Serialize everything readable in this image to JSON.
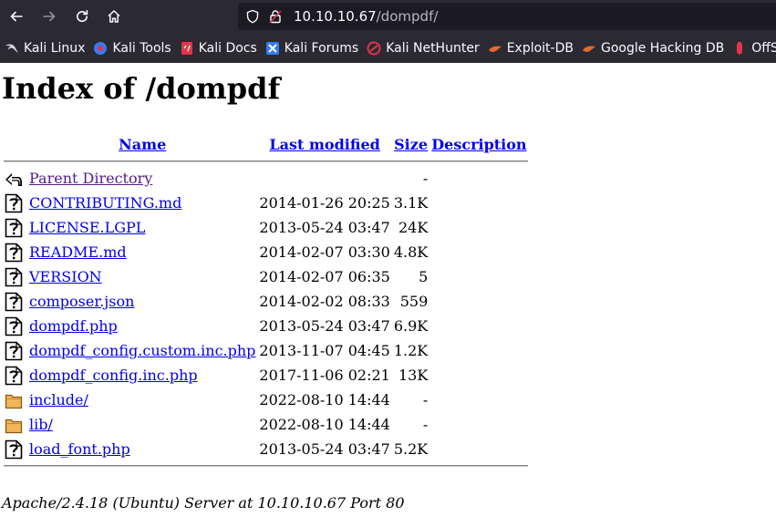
{
  "browser": {
    "url_host": "10.10.10.67",
    "url_path": "/dompdf/",
    "bookmarks": [
      {
        "label": "Kali Linux",
        "icon": "kali-dragon-icon"
      },
      {
        "label": "Kali Tools",
        "icon": "kali-tools-icon"
      },
      {
        "label": "Kali Docs",
        "icon": "kali-docs-icon"
      },
      {
        "label": "Kali Forums",
        "icon": "kali-forums-icon"
      },
      {
        "label": "Kali NetHunter",
        "icon": "kali-nethunter-icon"
      },
      {
        "label": "Exploit-DB",
        "icon": "exploit-db-icon"
      },
      {
        "label": "Google Hacking DB",
        "icon": "ghdb-icon"
      },
      {
        "label": "OffSec",
        "icon": "offsec-icon"
      }
    ]
  },
  "page": {
    "title": "Index of /dompdf",
    "columns": {
      "name": "Name",
      "last_modified": "Last modified",
      "size": "Size",
      "description": "Description"
    },
    "parent": {
      "name": "Parent Directory",
      "size": "-"
    },
    "rows": [
      {
        "name": "CONTRIBUTING.md",
        "modified": "2014-01-26 20:25",
        "size": "3.1K",
        "type": "file"
      },
      {
        "name": "LICENSE.LGPL",
        "modified": "2013-05-24 03:47",
        "size": "24K",
        "type": "file"
      },
      {
        "name": "README.md",
        "modified": "2014-02-07 03:30",
        "size": "4.8K",
        "type": "file"
      },
      {
        "name": "VERSION",
        "modified": "2014-02-07 06:35",
        "size": "5",
        "type": "file"
      },
      {
        "name": "composer.json",
        "modified": "2014-02-02 08:33",
        "size": "559",
        "type": "file"
      },
      {
        "name": "dompdf.php",
        "modified": "2013-05-24 03:47",
        "size": "6.9K",
        "type": "file"
      },
      {
        "name": "dompdf_config.custom.inc.php",
        "modified": "2013-11-07 04:45",
        "size": "1.2K",
        "type": "file"
      },
      {
        "name": "dompdf_config.inc.php",
        "modified": "2017-11-06 02:21",
        "size": "13K",
        "type": "file"
      },
      {
        "name": "include/",
        "modified": "2022-08-10 14:44",
        "size": "-",
        "type": "folder"
      },
      {
        "name": "lib/",
        "modified": "2022-08-10 14:44",
        "size": "-",
        "type": "folder"
      },
      {
        "name": "load_font.php",
        "modified": "2013-05-24 03:47",
        "size": "5.2K",
        "type": "file"
      }
    ],
    "footer": "Apache/2.4.18 (Ubuntu) Server at 10.10.10.67 Port 80"
  },
  "colors": {
    "chrome_bg": "#2b2a33",
    "urlbar_bg": "#1c1b22",
    "link": "#0000ee",
    "visited_link": "#551a8b"
  }
}
